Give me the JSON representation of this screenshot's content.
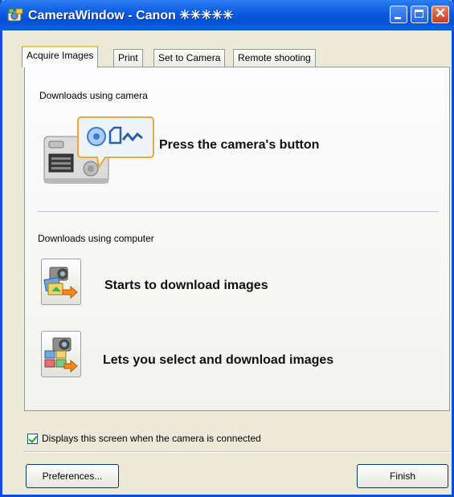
{
  "window": {
    "title": "CameraWindow - Canon ✳✳✳✳✳"
  },
  "tabs": [
    "Acquire Images",
    "Print",
    "Set to Camera",
    "Remote shooting"
  ],
  "camera_section": {
    "label": "Downloads using camera",
    "instruction": "Press the camera's button"
  },
  "computer_section": {
    "label": "Downloads using computer",
    "option1": "Starts to download images",
    "option2": "Lets you select and download images"
  },
  "footer": {
    "checkbox_label": "Displays this screen when the camera is connected",
    "checkbox_checked": true,
    "preferences_label": "Preferences...",
    "finish_label": "Finish"
  }
}
